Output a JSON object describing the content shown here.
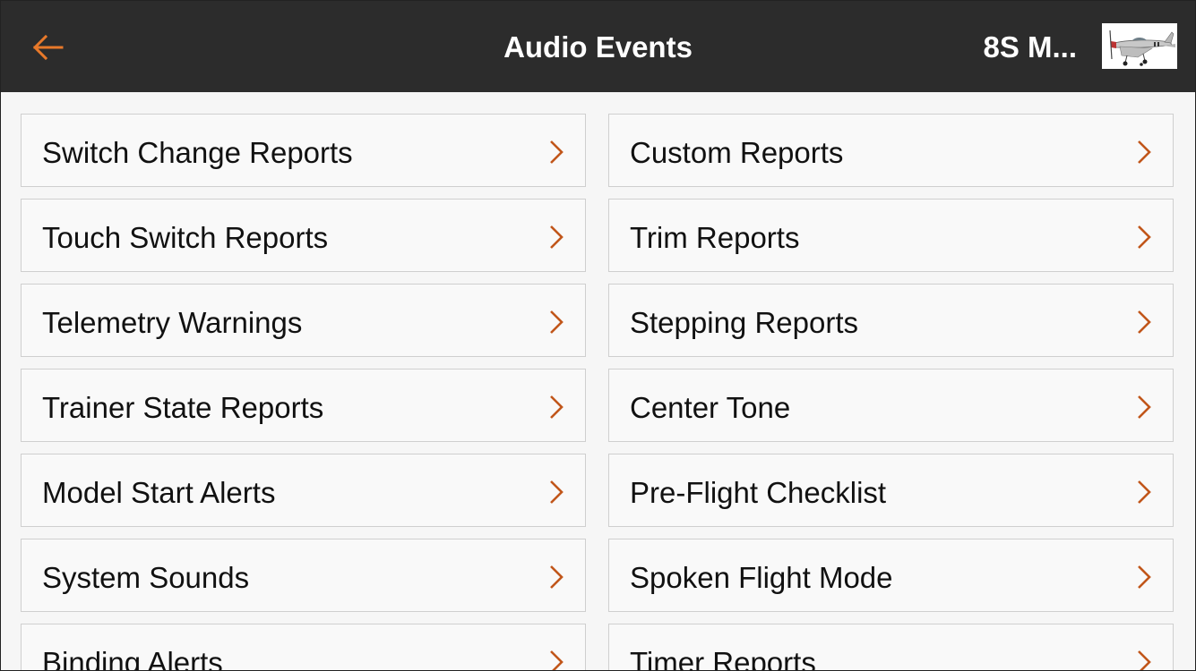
{
  "header": {
    "title": "Audio Events",
    "model_name": "8S M...",
    "back_icon": "arrow-left-icon",
    "thumbnail": "model-airplane-thumbnail"
  },
  "colors": {
    "header_bg": "#2c2c2c",
    "accent": "#e8792a",
    "chevron": "#c1561a",
    "item_bg": "#f9f9f9",
    "item_border": "#cfcfcf"
  },
  "left_items": [
    {
      "label": "Switch Change Reports"
    },
    {
      "label": "Touch Switch Reports"
    },
    {
      "label": "Telemetry Warnings"
    },
    {
      "label": "Trainer State Reports"
    },
    {
      "label": "Model Start Alerts"
    },
    {
      "label": "System Sounds"
    },
    {
      "label": "Binding Alerts"
    }
  ],
  "right_items": [
    {
      "label": "Custom Reports"
    },
    {
      "label": "Trim Reports"
    },
    {
      "label": "Stepping Reports"
    },
    {
      "label": "Center Tone"
    },
    {
      "label": "Pre-Flight Checklist"
    },
    {
      "label": "Spoken Flight Mode"
    },
    {
      "label": "Timer Reports"
    }
  ]
}
